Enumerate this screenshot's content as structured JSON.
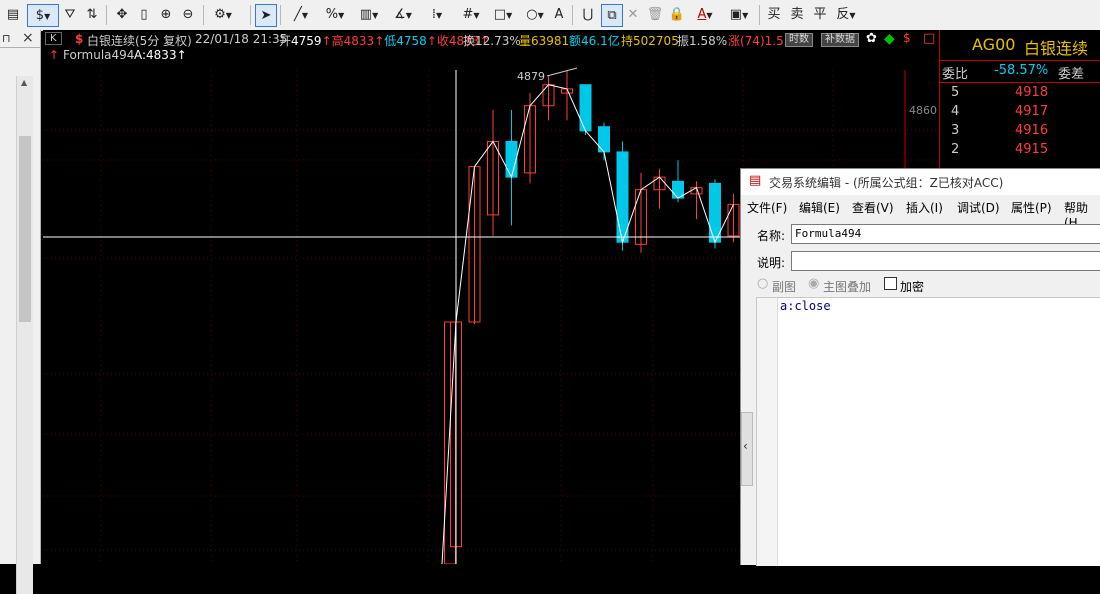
{
  "toolbar": {
    "items": [
      "▤",
      "$",
      "⛛",
      "⇅",
      "✥",
      "▯",
      "⊕",
      "⊖",
      "⚙",
      "➤",
      "╱",
      "%",
      "▥",
      "∡",
      "⁞",
      "#",
      "□",
      "○",
      "A",
      "⋃",
      "⧉",
      "✕",
      "🗑",
      "🔒",
      "A",
      "▣"
    ],
    "trade": [
      "买",
      "卖",
      "平",
      "反"
    ]
  },
  "left": {
    "pin": "⊓",
    "close": "×"
  },
  "chart": {
    "k_btn": "K",
    "mark": "$",
    "title": "白银连续(5分 复权)",
    "datetime": "22/01/18 21:35",
    "open_label": "开",
    "open": "4759",
    "high_label": "高",
    "high": "4833",
    "low_label": "低",
    "low": "4758",
    "close_label": "收",
    "close": "4833",
    "turnover_label": "换",
    "turnover": "12.73%",
    "volume_label": "量",
    "volume": "63981",
    "amount_label": "额",
    "amount": "46.1亿",
    "oi_label": "持",
    "oi": "502705",
    "amp_label": "振",
    "amp": "1.58%",
    "chg_label": "涨",
    "chg": "(74)1.5",
    "btn_time": "时数",
    "btn_supp": "补数据",
    "formula_name": "Formula494",
    "formula_val": "A:4833",
    "peak_label": "4879",
    "axis_label": "4860"
  },
  "quote": {
    "code": "AG00",
    "name": "白银连续",
    "ratio_label": "委比",
    "ratio": "-58.57%",
    "diff_label": "委差",
    "levels": [
      {
        "n": "5",
        "price": "4918"
      },
      {
        "n": "4",
        "price": "4917"
      },
      {
        "n": "3",
        "price": "4916"
      },
      {
        "n": "2",
        "price": "4915"
      }
    ]
  },
  "dialog": {
    "title": "交易系统编辑 - (所属公式组：Z已核对ACC)",
    "menu": [
      "文件(F)",
      "编辑(E)",
      "查看(V)",
      "插入(I)",
      "调试(D)",
      "属性(P)",
      "帮助(H"
    ],
    "name_label": "名称:",
    "name_value": "Formula494",
    "desc_label": "说明:",
    "desc_value": "",
    "opt_sub": "副图",
    "opt_main": "主图叠加",
    "opt_encrypt": "加密",
    "code": "a:close",
    "collapse": "‹"
  },
  "colors": {
    "up": "#ff3c3c",
    "down": "#00c8e8",
    "bg": "#000000"
  },
  "chart_data": {
    "type": "candlestick",
    "candles": [
      {
        "o": 4652,
        "h": 4760,
        "l": 4620,
        "c": 4759
      },
      {
        "o": 4759,
        "h": 4833,
        "l": 4758,
        "c": 4833
      },
      {
        "o": 4810,
        "h": 4860,
        "l": 4800,
        "c": 4845
      },
      {
        "o": 4845,
        "h": 4860,
        "l": 4805,
        "c": 4828
      },
      {
        "o": 4830,
        "h": 4868,
        "l": 4825,
        "c": 4862
      },
      {
        "o": 4862,
        "h": 4876,
        "l": 4855,
        "c": 4872
      },
      {
        "o": 4868,
        "h": 4879,
        "l": 4855,
        "c": 4870
      },
      {
        "o": 4872,
        "h": 4872,
        "l": 4848,
        "c": 4850
      },
      {
        "o": 4852,
        "h": 4854,
        "l": 4836,
        "c": 4840
      },
      {
        "o": 4840,
        "h": 4845,
        "l": 4793,
        "c": 4797
      },
      {
        "o": 4796,
        "h": 4830,
        "l": 4792,
        "c": 4822
      },
      {
        "o": 4822,
        "h": 4832,
        "l": 4813,
        "c": 4828
      },
      {
        "o": 4826,
        "h": 4836,
        "l": 4816,
        "c": 4818
      },
      {
        "o": 4820,
        "h": 4826,
        "l": 4808,
        "c": 4823
      },
      {
        "o": 4825,
        "h": 4827,
        "l": 4794,
        "c": 4797
      },
      {
        "o": 4800,
        "h": 4820,
        "l": 4797,
        "c": 4815
      }
    ],
    "formula": "close"
  }
}
